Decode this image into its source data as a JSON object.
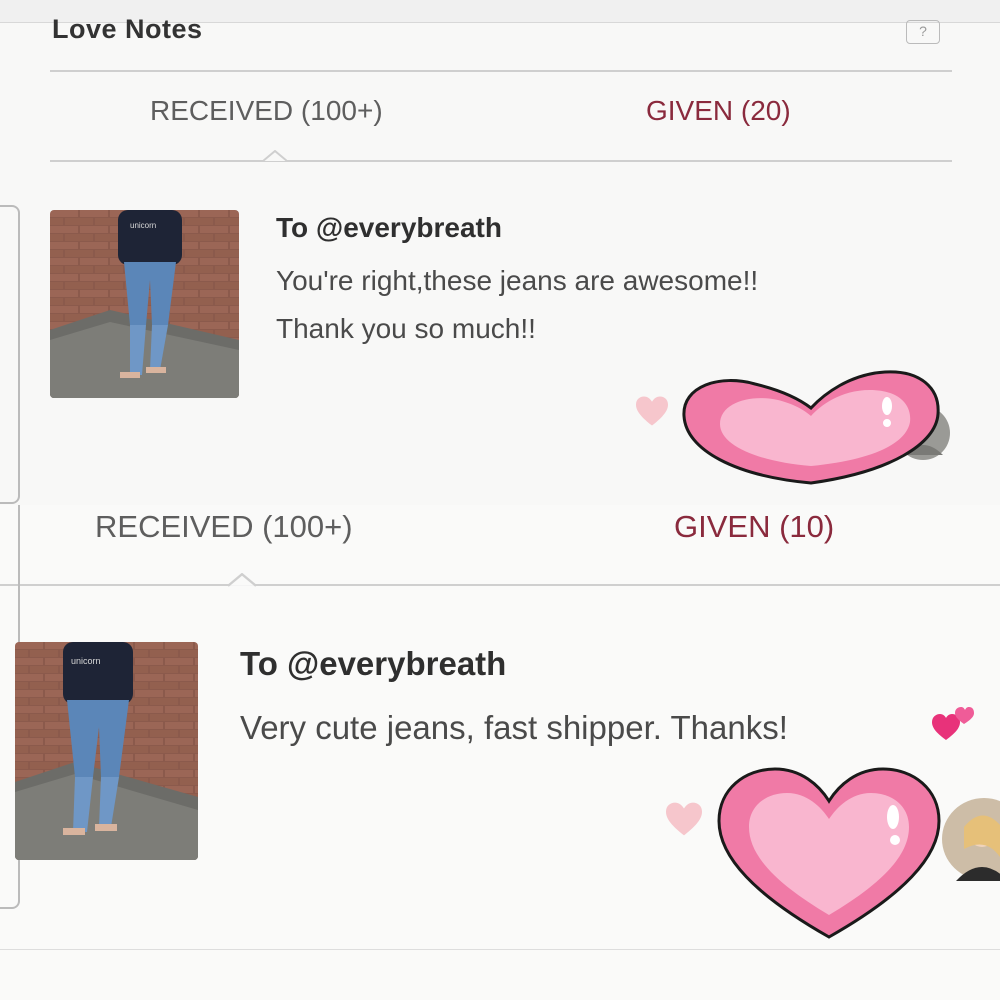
{
  "section_title": "Love Notes",
  "help_icon_label": "?",
  "top": {
    "tabs": {
      "received": "RECEIVED (100+)",
      "given": "GIVEN (20)"
    },
    "note": {
      "to": "To @everybreath",
      "message_line1": "You're right,these jeans are awesome!!",
      "message_line2": "Thank you so much!!"
    }
  },
  "bottom": {
    "tabs": {
      "received": "RECEIVED (100+)",
      "given": "GIVEN (10)"
    },
    "note": {
      "to": "To @everybreath",
      "message": "Very cute jeans, fast shipper. Thanks!"
    }
  },
  "icons": {
    "like": "heart-icon",
    "sticker": "big-pink-heart-sticker",
    "emoji": "two-hearts-emoji",
    "avatar": "user-avatar",
    "help": "help-icon"
  },
  "colors": {
    "given_tab": "#8a2a3d",
    "received_tab": "#5e5e5e",
    "heart_pink": "#f58fb4",
    "heart_light": "#f9bcd2",
    "like_heart": "#f6c6cc"
  }
}
